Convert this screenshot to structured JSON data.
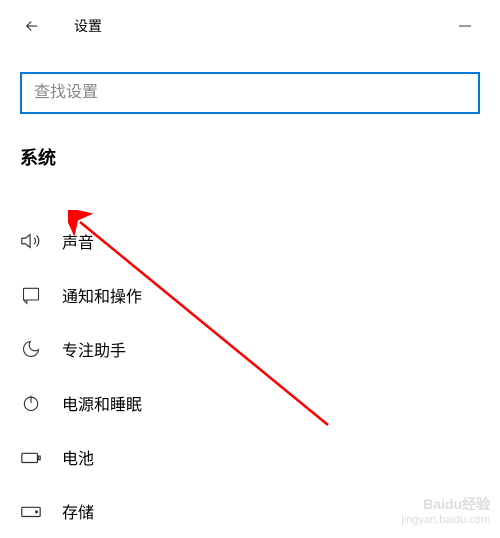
{
  "header": {
    "title": "设置"
  },
  "search": {
    "placeholder": "查找设置"
  },
  "section": {
    "title": "系统"
  },
  "menu": {
    "items": [
      {
        "label": "声音"
      },
      {
        "label": "通知和操作"
      },
      {
        "label": "专注助手"
      },
      {
        "label": "电源和睡眠"
      },
      {
        "label": "电池"
      },
      {
        "label": "存储"
      }
    ]
  },
  "watermark": {
    "brand": "Baidu经验",
    "url": "jingyan.baidu.com"
  }
}
